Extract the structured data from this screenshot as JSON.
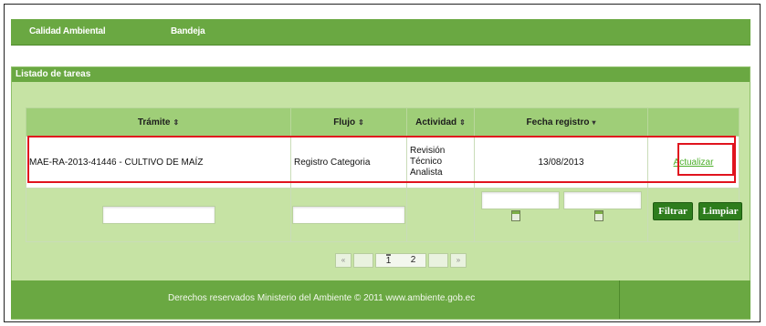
{
  "nav": {
    "items": [
      {
        "label": "Calidad Ambiental"
      },
      {
        "label": "Bandeja"
      }
    ]
  },
  "panel": {
    "title": "Listado de tareas",
    "columns": [
      {
        "label": "Trámite",
        "sort": "⇕"
      },
      {
        "label": "Flujo",
        "sort": "⇕"
      },
      {
        "label": "Actividad",
        "sort": "⇕"
      },
      {
        "label": "Fecha registro",
        "sort": "▾"
      },
      {
        "label": ""
      }
    ],
    "rows": [
      {
        "tramite": "MAE-RA-2013-41446 - CULTIVO DE MAÍZ",
        "flujo": "Registro Categoria",
        "actividad": [
          "Revisión",
          "Técnico",
          "Analista"
        ],
        "fecha": "13/08/2013",
        "action": "Actualizar"
      }
    ],
    "filter": {
      "tramite": "",
      "flujo": "",
      "fecha_desde": "",
      "fecha_hasta": "",
      "filter_button": "Filtrar",
      "clear_button": "Limpiar"
    },
    "pagination": {
      "first": "«",
      "last": "»",
      "pages": [
        "1",
        "2"
      ],
      "current": "1"
    }
  },
  "footer": {
    "text": "Derechos reservados Ministerio del Ambiente © 2011 www.ambiente.gob.ec"
  },
  "colors": {
    "accent_green": "#6aa842",
    "panel_bg": "#c6e3a4",
    "highlight_red": "#e0141e",
    "button_green": "#2e7d1d"
  }
}
